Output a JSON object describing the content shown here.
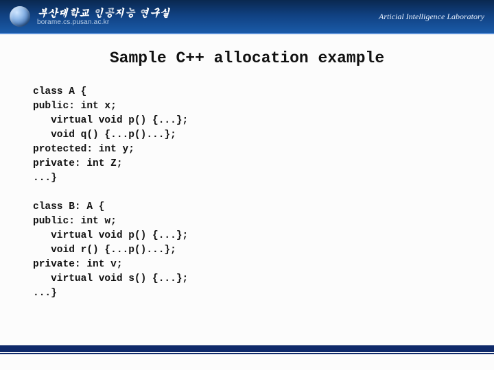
{
  "header": {
    "title": "부산대학교 인공지능 연구실",
    "subtitle": "borame.cs.pusan.ac.kr",
    "lab_name": "Articial Intelligence Laboratory",
    "logo_name": "globe-logo-icon"
  },
  "slide": {
    "title": "Sample C++ allocation example",
    "code": "class A {\npublic: int x;\n   virtual void p() {...};\n   void q() {...p()...};\nprotected: int y;\nprivate: int Z;\n...}\n\nclass B: A {\npublic: int w;\n   virtual void p() {...};\n   void r() {...p()...};\nprivate: int v;\n   virtual void s() {...};\n...}"
  },
  "colors": {
    "header_gradient_top": "#0a2850",
    "header_gradient_bottom": "#1a5aa8",
    "footer_bar": "#0f2a6a"
  }
}
